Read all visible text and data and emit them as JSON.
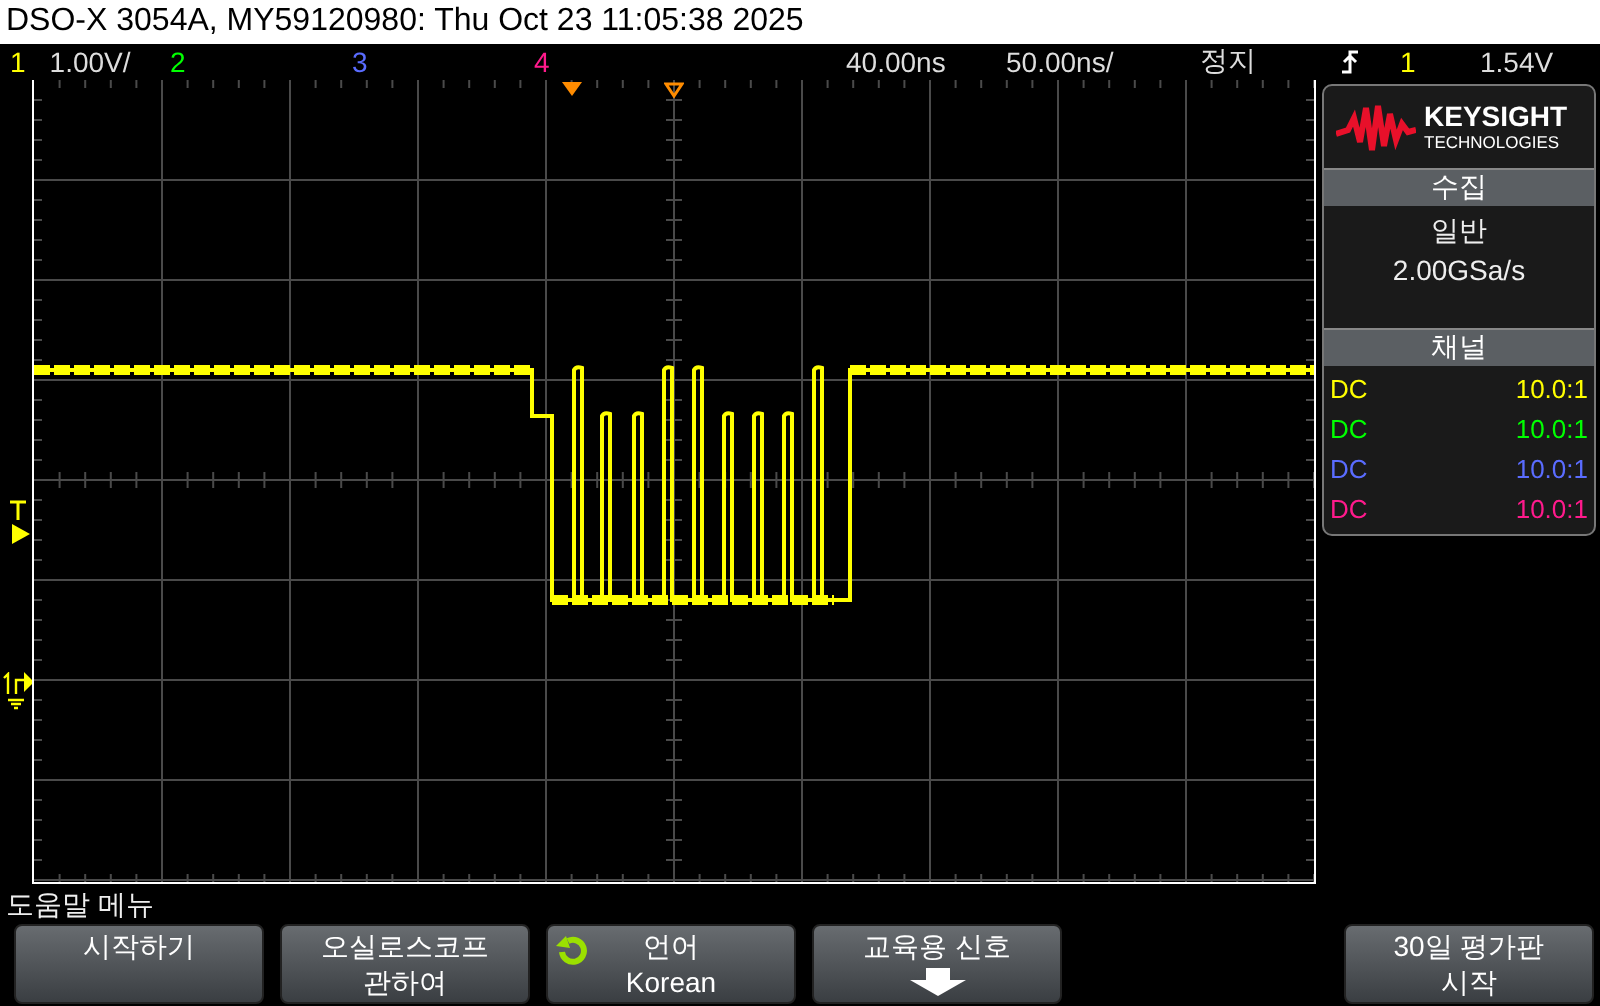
{
  "window": {
    "title": "DSO-X 3054A, MY59120980: Thu Oct 23 11:05:38 2025"
  },
  "status_bar": {
    "channels": [
      {
        "number": "1",
        "scale": "1.00V/",
        "color": "#ffff00"
      },
      {
        "number": "2",
        "color": "#00ff00"
      },
      {
        "number": "3",
        "color": "#5a6cff"
      },
      {
        "number": "4",
        "color": "#ff1a8c"
      }
    ],
    "delay": "40.00ns",
    "timebase": "50.00ns/",
    "run_state": "정지",
    "trigger_source": "1",
    "trigger_level": "1.54V"
  },
  "side_panel": {
    "logo": {
      "brand": "KEYSIGHT",
      "sub": "TECHNOLOGIES"
    },
    "acquisition": {
      "header": "수집",
      "mode": "일반",
      "sample_rate": "2.00GSa/s"
    },
    "channels": {
      "header": "채널",
      "rows": [
        {
          "coupling": "DC",
          "probe": "10.0:1",
          "color": "#ffff00"
        },
        {
          "coupling": "DC",
          "probe": "10.0:1",
          "color": "#00ff00"
        },
        {
          "coupling": "DC",
          "probe": "10.0:1",
          "color": "#5a6cff"
        },
        {
          "coupling": "DC",
          "probe": "10.0:1",
          "color": "#ff1a8c"
        }
      ]
    }
  },
  "softkeys": {
    "title": "도움말 메뉴",
    "keys": [
      {
        "kind": "text",
        "label": "시작하기"
      },
      {
        "kind": "text",
        "label": "오실로스코프",
        "sub": "관하여"
      },
      {
        "kind": "cycle",
        "label": "언어",
        "value": "Korean"
      },
      {
        "kind": "arrow",
        "label": "교육용 신호"
      },
      {
        "kind": "text",
        "label": "30일 평가판",
        "sub": "시작"
      }
    ]
  }
}
